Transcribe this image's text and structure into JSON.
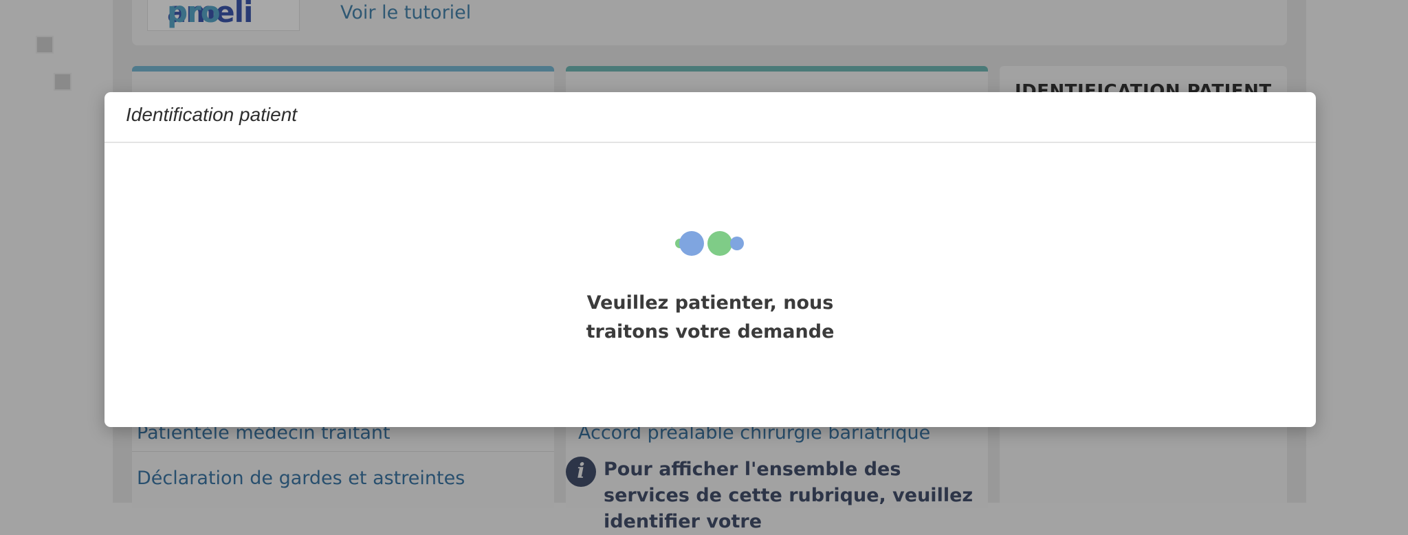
{
  "header": {
    "logo": {
      "part1": "ameli",
      "part2": "pro"
    },
    "tutorial_link": "Voir le tutoriel"
  },
  "cards": {
    "card1": {
      "link1": "Patientèle médecin traitant",
      "link2": "Déclaration de gardes et astreintes"
    },
    "card2": {
      "link1": "Accord préalable chirurgie bariatrique",
      "info_text": "Pour afficher l'ensemble des services de cette rubrique, veuillez identifier votre"
    },
    "card3": {
      "title": "IDENTIFICATION PATIENT"
    }
  },
  "modal": {
    "title": "Identification patient",
    "loading_line1": "Veuillez patienter, nous",
    "loading_line2": "traitons votre demande"
  },
  "colors": {
    "loader_blue": "#7fa5e0",
    "loader_green": "#7fcc87",
    "link": "#284f6e",
    "brand_dark": "#283a74"
  },
  "icons": {
    "info": "info-icon"
  }
}
